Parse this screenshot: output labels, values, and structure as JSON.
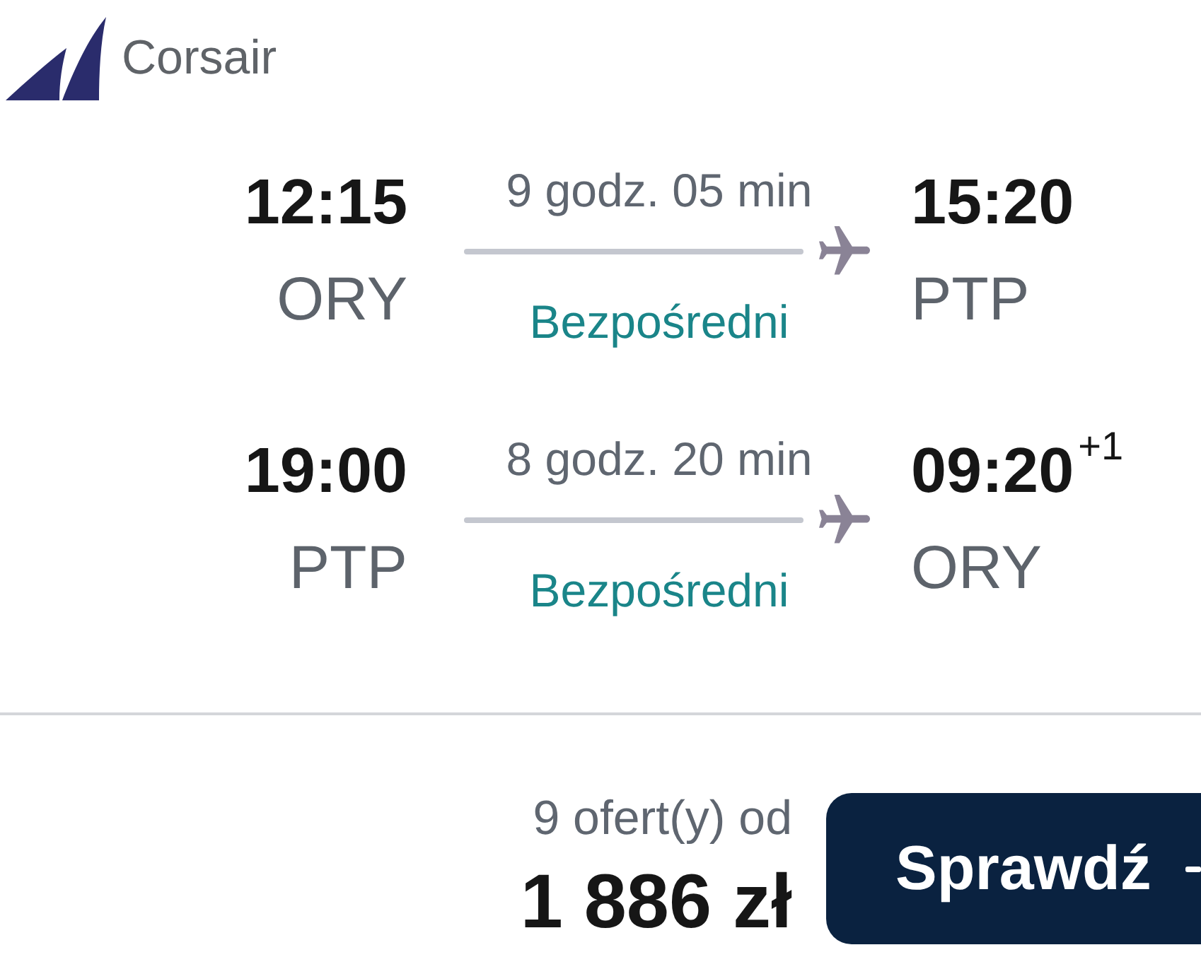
{
  "carrier": {
    "name": "Corsair"
  },
  "legs": [
    {
      "departure": {
        "time": "12:15",
        "airport": "ORY"
      },
      "duration": "9 godz. 05 min",
      "stops": "Bezpośredni",
      "arrival": {
        "time": "15:20",
        "airport": "PTP"
      }
    },
    {
      "departure": {
        "time": "19:00",
        "airport": "PTP"
      },
      "duration": "8 godz. 20 min",
      "stops": "Bezpośredni",
      "arrival": {
        "time": "09:20",
        "day_offset": "+1",
        "airport": "ORY"
      }
    }
  ],
  "offer": {
    "count_label": "9 ofert(y) od",
    "price": "1 886 zł",
    "button": "Sprawdź"
  }
}
